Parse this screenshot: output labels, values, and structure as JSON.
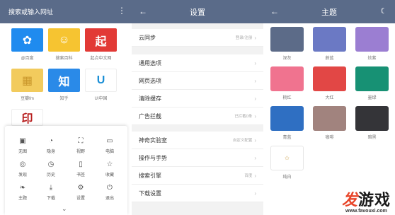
{
  "browser": {
    "search_placeholder": "搜索或输入网址",
    "tiles": [
      {
        "label": "@百度",
        "icon": "baidu-paw-icon",
        "glyph": "✿",
        "color": "#1f8bef"
      },
      {
        "label": "搜索百科",
        "icon": "baike-face-icon",
        "glyph": "☺",
        "color": "#f6c431"
      },
      {
        "label": "起点中文网",
        "icon": "qidian-icon",
        "glyph": "起",
        "color": "#e23a36"
      },
      {
        "label": "豆瓣fm",
        "icon": "douban-fm-icon",
        "glyph": "▦",
        "color": "#f2cb5d"
      },
      {
        "label": "知乎",
        "icon": "zhihu-icon",
        "glyph": "知",
        "color": "#2a8ae8"
      },
      {
        "label": "UI中国",
        "icon": "ui-china-icon",
        "glyph": "U",
        "color": "#ffffff"
      },
      {
        "label": "",
        "icon": "seal-stamp-icon",
        "glyph": "印",
        "color": "#ffffff"
      }
    ],
    "menu": [
      {
        "label": "无图",
        "icon": "image-icon",
        "glyph": "▣"
      },
      {
        "label": "隐身",
        "icon": "incognito-icon",
        "glyph": "◔"
      },
      {
        "label": "视野",
        "icon": "fullscreen-icon",
        "glyph": "⛶"
      },
      {
        "label": "电脑",
        "icon": "desktop-icon",
        "glyph": "▭"
      },
      {
        "label": "发现",
        "icon": "discover-icon",
        "glyph": "◎"
      },
      {
        "label": "历史",
        "icon": "history-clock-icon",
        "glyph": "◷"
      },
      {
        "label": "书签",
        "icon": "bookmark-book-icon",
        "glyph": "▯"
      },
      {
        "label": "收藏",
        "icon": "star-icon",
        "glyph": "☆"
      },
      {
        "label": "主题",
        "icon": "theme-leaf-icon",
        "glyph": "❧"
      },
      {
        "label": "下载",
        "icon": "download-icon",
        "glyph": "⤓"
      },
      {
        "label": "设置",
        "icon": "settings-gear-icon",
        "glyph": "⚙"
      },
      {
        "label": "退出",
        "icon": "power-icon",
        "glyph": "⏻"
      }
    ]
  },
  "settings": {
    "title": "设置",
    "rows": [
      {
        "label": "云同步",
        "value": "登录/注册"
      },
      {
        "label": "通用选项",
        "value": ""
      },
      {
        "label": "网页选项",
        "value": ""
      },
      {
        "label": "清除缓存",
        "value": ""
      },
      {
        "label": "广告拦截",
        "value": "已拦截0条"
      },
      {
        "label": "神奇实验室",
        "value": "自定义配置"
      },
      {
        "label": "操作与手势",
        "value": ""
      },
      {
        "label": "搜索引擎",
        "value": "百度"
      },
      {
        "label": "下载设置",
        "value": ""
      }
    ]
  },
  "theme": {
    "title": "主题",
    "swatches": [
      {
        "name": "深灰",
        "color": "#5c6b88"
      },
      {
        "name": "蔚蓝",
        "color": "#6b79c4"
      },
      {
        "name": "炫紫",
        "color": "#9b7ed2"
      },
      {
        "name": "桃红",
        "color": "#f0738f"
      },
      {
        "name": "大红",
        "color": "#e24745"
      },
      {
        "name": "墨绿",
        "color": "#179174"
      },
      {
        "name": "青蓝",
        "color": "#2f6fc2"
      },
      {
        "name": "咖啡",
        "color": "#a1837e"
      },
      {
        "name": "暗黑",
        "color": "#343438"
      },
      {
        "name": "纯白",
        "color": "#ffffff"
      }
    ]
  },
  "watermark": {
    "brand_accent": "发",
    "brand_rest": "游戏",
    "url": "www.favouxi.com"
  }
}
